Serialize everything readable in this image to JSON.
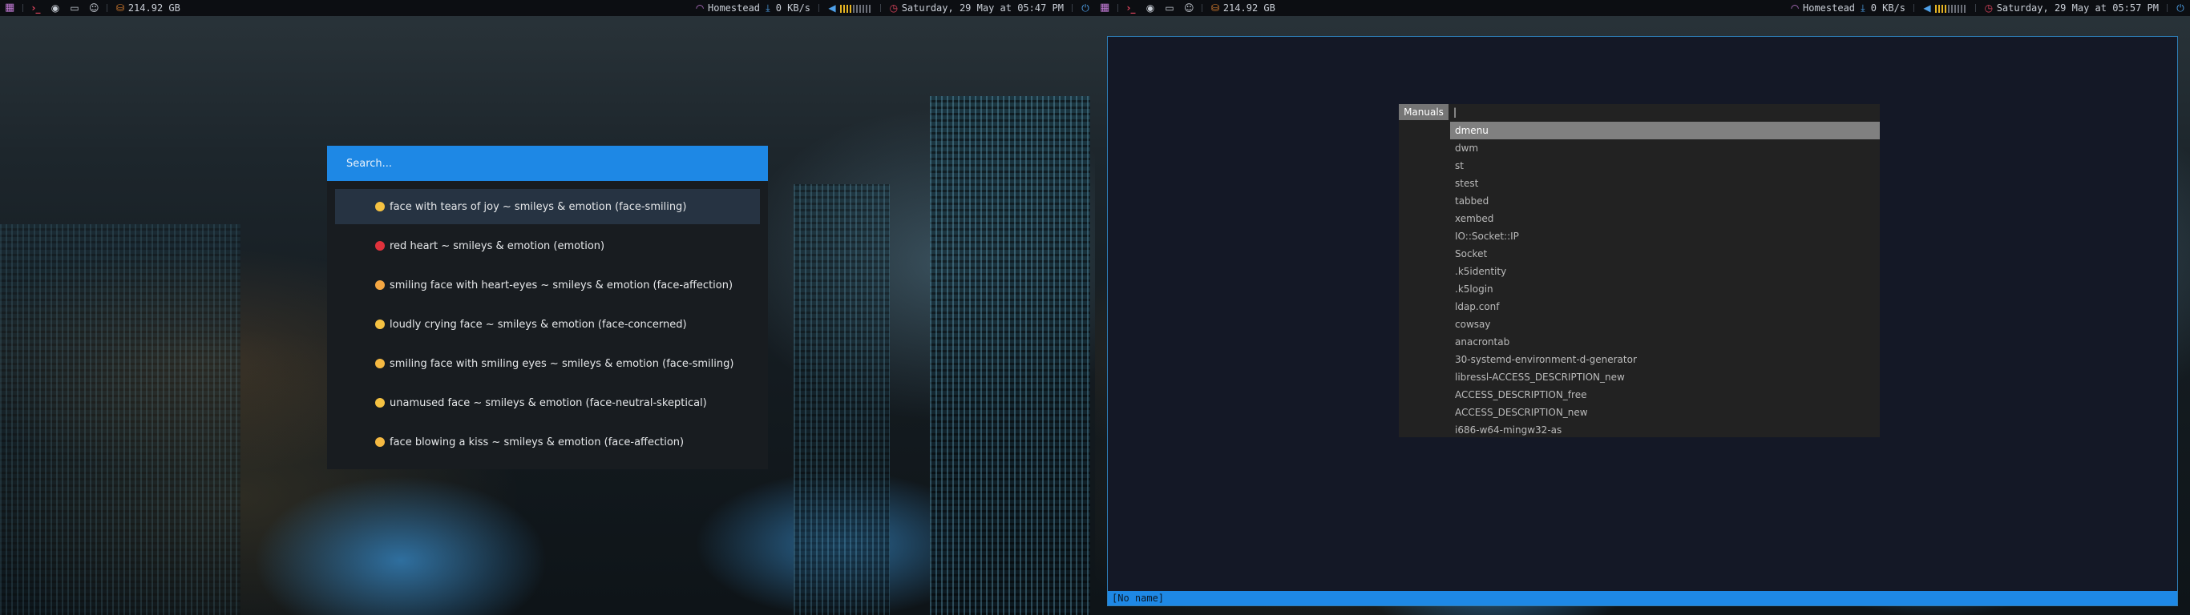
{
  "bars": [
    {
      "disk": "214.92 GB",
      "network": "Homestead",
      "download": "0 KB/s",
      "clock": "Saturday, 29 May at 05:47 PM"
    },
    {
      "disk": "214.92 GB",
      "network": "Homestead",
      "download": "0 KB/s",
      "clock": "Saturday, 29 May at 05:57 PM"
    }
  ],
  "volume_level": 0.4,
  "rofi": {
    "placeholder": "Search...",
    "items": [
      {
        "label": "face with tears of joy ~ smileys & emotion (face-smiling)",
        "color": "#f5c242",
        "selected": true
      },
      {
        "label": "red heart ~ smileys & emotion (emotion)",
        "color": "#e0323c"
      },
      {
        "label": "smiling face with heart-eyes ~ smileys & emotion (face-affection)",
        "color": "#f5a742"
      },
      {
        "label": "loudly crying face ~ smileys & emotion (face-concerned)",
        "color": "#f5c242"
      },
      {
        "label": "smiling face with smiling eyes ~ smileys & emotion (face-smiling)",
        "color": "#f5b942"
      },
      {
        "label": "unamused face ~ smileys & emotion (face-neutral-skeptical)",
        "color": "#f5c242"
      },
      {
        "label": "face blowing a kiss ~ smileys & emotion (face-affection)",
        "color": "#f5b942"
      }
    ]
  },
  "dmenu": {
    "prompt": "Manuals",
    "input": "|",
    "items": [
      "dmenu",
      "dwm",
      "st",
      "stest",
      "tabbed",
      "xembed",
      "IO::Socket::IP",
      "Socket",
      ".k5identity",
      ".k5login",
      "ldap.conf",
      "cowsay",
      "anacrontab",
      "30-systemd-environment-d-generator",
      "libressl-ACCESS_DESCRIPTION_new",
      "ACCESS_DESCRIPTION_free",
      "ACCESS_DESCRIPTION_new",
      "i686-w64-mingw32-as"
    ],
    "selected_index": 0
  },
  "editor": {
    "statusline": "[No name]"
  },
  "colors": {
    "accent": "#1e88e5",
    "bar_bg": "#0c0e12",
    "rofi_bg": "#181c20",
    "dmenu_bg": "#222222"
  }
}
